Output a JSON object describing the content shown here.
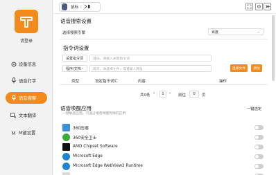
{
  "sidebar": {
    "login_label": "请登录",
    "items": [
      {
        "label": "设备信息",
        "icon": "device-icon",
        "active": false
      },
      {
        "label": "语音打字",
        "icon": "mic-icon",
        "active": false
      },
      {
        "label": "语音搜索",
        "icon": "voice-search-icon",
        "active": true
      },
      {
        "label": "文本翻译",
        "icon": "translate-icon",
        "active": false
      },
      {
        "label": "M键设置",
        "icon": "m-key-icon",
        "active": false
      }
    ]
  },
  "topbar": {
    "device_name": "鼠标",
    "controls": [
      "screenshot-icon",
      "settings-icon",
      "minimize-icon",
      "close-icon"
    ]
  },
  "voice_search": {
    "title": "语音搜索设置",
    "engine_label": "选择搜索引擎",
    "engine_value": "百度"
  },
  "commands": {
    "title": "指令词设置",
    "type1": "设置指令词",
    "placeholder1": "首先，请输入关键指令词",
    "type2": "程序/文档",
    "placeholder2": "其次，请选择文件，或者输入网址",
    "browse_button": "选择文件",
    "add_button": "添加",
    "headers": [
      "类型",
      "设定指令词汇",
      "内容",
      "操作"
    ],
    "pager": {
      "total": "共0条",
      "page": "1",
      "goto_label": "前往",
      "goto_value": "0",
      "page_suffix": "页"
    }
  },
  "wake_apps": {
    "title": "语音唤醒应用",
    "subtitle": "一键敏感应用，可通过语音唤醒而弹的应用",
    "select_all": "一键选定",
    "apps": [
      {
        "name": "360压缩",
        "icon": "360zip-icon",
        "color": "#3b8fd9"
      },
      {
        "name": "360安全卫士",
        "icon": "360safe-icon",
        "color": "#3dab3a"
      },
      {
        "name": "AMD Chipset Software",
        "icon": "amd-icon",
        "color": "#111111"
      },
      {
        "name": "Microsoft Edge",
        "icon": "edge-icon",
        "color": "#1d86d0"
      },
      {
        "name": "Microsoft Edge WebView2 Runtime",
        "icon": "edge-webview-icon",
        "color": "#1d86d0"
      },
      {
        "name": "",
        "icon": "app-icon",
        "color": "#dadada"
      }
    ]
  },
  "colors": {
    "accent": "#f28a1c"
  }
}
